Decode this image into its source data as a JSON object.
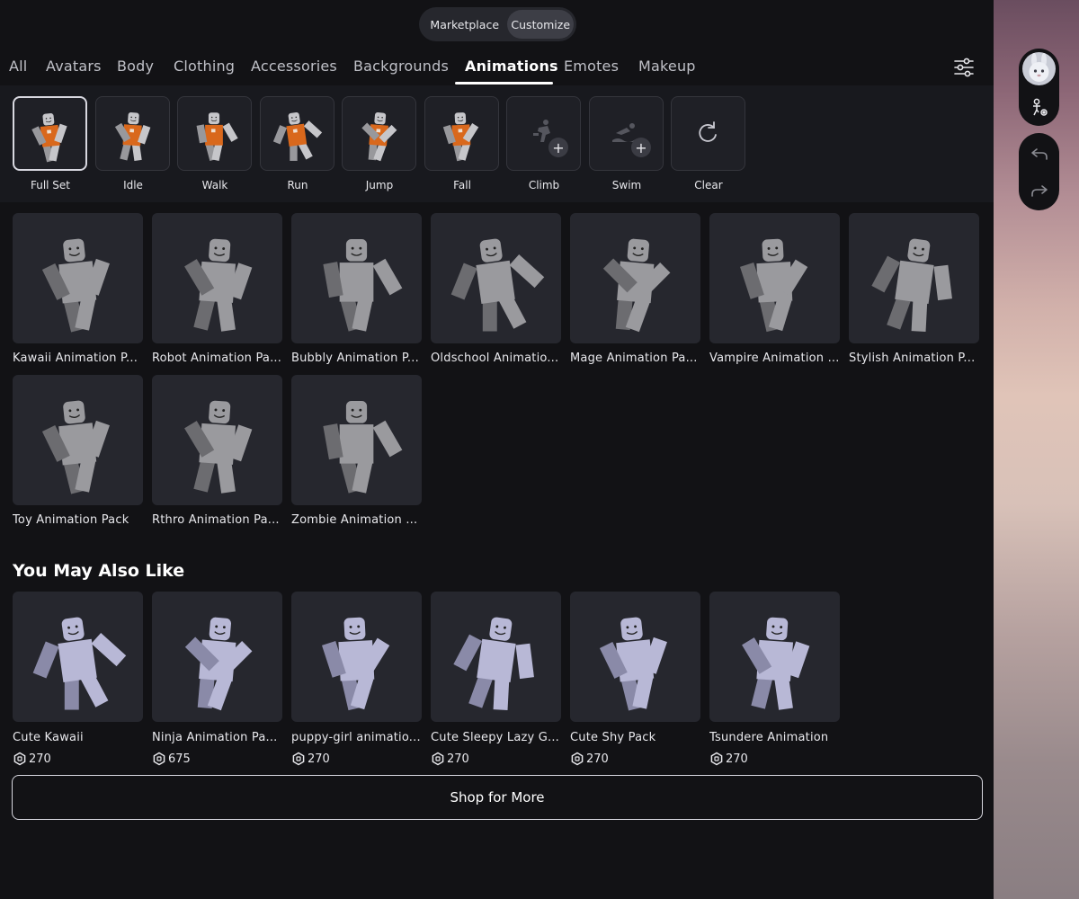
{
  "toggle": {
    "marketplace": "Marketplace",
    "customize": "Customize"
  },
  "tabs": [
    "All",
    "Avatars",
    "Body",
    "Clothing",
    "Accessories",
    "Backgrounds",
    "Animations",
    "Emotes",
    "Makeup"
  ],
  "active_tab": "Animations",
  "slots": [
    {
      "label": "Full Set",
      "selected": true,
      "empty": false
    },
    {
      "label": "Idle",
      "empty": false
    },
    {
      "label": "Walk",
      "empty": false
    },
    {
      "label": "Run",
      "empty": false
    },
    {
      "label": "Jump",
      "empty": false
    },
    {
      "label": "Fall",
      "empty": false
    },
    {
      "label": "Climb",
      "empty": true,
      "icon": "climb-icon"
    },
    {
      "label": "Swim",
      "empty": true,
      "icon": "swim-icon"
    },
    {
      "label": "Clear",
      "empty": true,
      "icon": "refresh-icon"
    }
  ],
  "owned_items": [
    "Kawaii Animation P...",
    "Robot Animation Pa...",
    "Bubbly Animation P...",
    "Oldschool Animatio...",
    "Mage Animation Pa...",
    "Vampire Animation ...",
    "Stylish Animation P...",
    "Toy Animation Pack",
    "Rthro Animation Pa...",
    "Zombie Animation ..."
  ],
  "recommend_title": "You May Also Like",
  "recommended": [
    {
      "name": "Cute Kawaii",
      "price": "270"
    },
    {
      "name": "Ninja Animation Pa...",
      "price": "675"
    },
    {
      "name": "puppy-girl animatio...",
      "price": "270"
    },
    {
      "name": "Cute Sleepy Lazy G...",
      "price": "270"
    },
    {
      "name": "Cute Shy Pack",
      "price": "270"
    },
    {
      "name": "Tsundere Animation",
      "price": "270"
    }
  ],
  "shop_button": "Shop for More",
  "colors": {
    "background": "#121215",
    "card": "#26272e",
    "figure_owned": "#9a9a9e",
    "figure_recommended": "#b8b8d6",
    "shirt": "#d9681c"
  }
}
